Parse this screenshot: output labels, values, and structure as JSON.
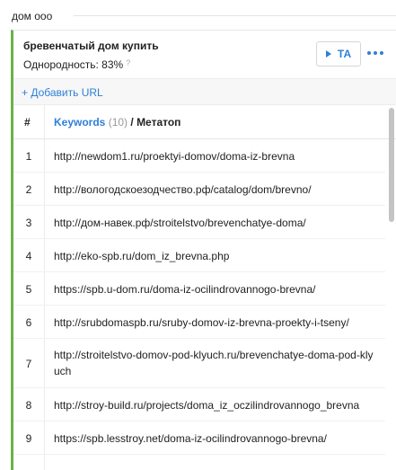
{
  "group": {
    "title": "дом ооо"
  },
  "card": {
    "keyword": "бревенчатый дом купить",
    "uniformity_label": "Однородность: 83%",
    "uniformity_help": "?",
    "ta_button_label": "ТА",
    "add_url_label": "+ Добавить URL"
  },
  "table": {
    "col_num": "#",
    "col_keywords": "Keywords",
    "col_keywords_count": "(10)",
    "col_separator": " / ",
    "col_meta": "Метатоп",
    "rows": [
      {
        "n": "1",
        "url": "http://newdom1.ru/proektyi-domov/doma-iz-brevna"
      },
      {
        "n": "2",
        "url": "http://вологодскоезодчество.рф/catalog/dom/brevno/"
      },
      {
        "n": "3",
        "url": "http://дом-навек.рф/stroitelstvo/brevenchatye-doma/"
      },
      {
        "n": "4",
        "url": "http://eko-spb.ru/dom_iz_brevna.php"
      },
      {
        "n": "5",
        "url": "https://spb.u-dom.ru/doma-iz-ocilindrovannogo-brevna/"
      },
      {
        "n": "6",
        "url": "http://srubdomaspb.ru/sruby-domov-iz-brevna-proekty-i-tseny/"
      },
      {
        "n": "7",
        "url": "http://stroitelstvo-domov-pod-klyuch.ru/brevenchatye-doma-pod-klyuch"
      },
      {
        "n": "8",
        "url": "http://stroy-build.ru/projects/doma_iz_oczilindrovannogo_brevna"
      },
      {
        "n": "9",
        "url": "https://spb.lesstroy.net/doma-iz-ocilindrovannogo-brevna/"
      }
    ]
  },
  "colors": {
    "accent": "#2f7fd8",
    "group_bar": "#6ab04c"
  },
  "icons": {
    "play": "play-icon",
    "more": "more-dots-icon",
    "help": "question-icon"
  }
}
